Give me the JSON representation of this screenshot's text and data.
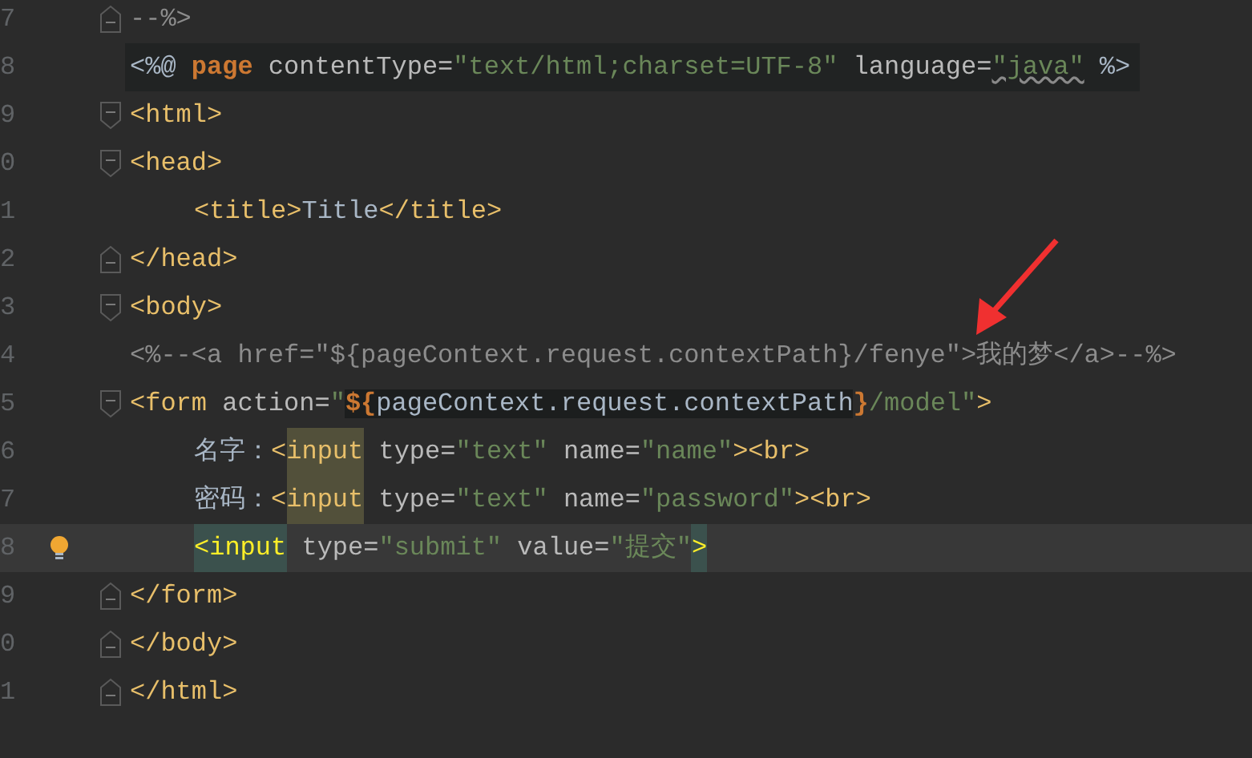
{
  "lines": [
    {
      "number": "7",
      "kind": "close",
      "current": false,
      "segments": [
        {
          "kind": "comment",
          "text": "--%>"
        }
      ]
    },
    {
      "number": "8",
      "kind": "plain",
      "current": false,
      "directive": true,
      "segments": [
        {
          "kind": "text",
          "text": "<%@"
        },
        {
          "kind": "keyword",
          "text": " page"
        },
        {
          "kind": "attr",
          "text": " contentType="
        },
        {
          "kind": "string",
          "text": "\"text/html;charset=UTF-8\""
        },
        {
          "kind": "attr",
          "text": " language="
        },
        {
          "kind": "string",
          "text": "\"java\"",
          "squiggle": true
        },
        {
          "kind": "text",
          "text": " %>"
        }
      ]
    },
    {
      "number": "9",
      "kind": "open",
      "current": false,
      "segments": [
        {
          "kind": "tag",
          "text": "<html>"
        }
      ]
    },
    {
      "number": "0",
      "kind": "open",
      "current": false,
      "segments": [
        {
          "kind": "tag",
          "text": "<head>"
        }
      ]
    },
    {
      "number": "1",
      "kind": "plain",
      "current": false,
      "indent": true,
      "segments": [
        {
          "kind": "tag",
          "text": "<title>"
        },
        {
          "kind": "text",
          "text": "Title"
        },
        {
          "kind": "tag",
          "text": "</title>"
        }
      ]
    },
    {
      "number": "2",
      "kind": "close",
      "current": false,
      "segments": [
        {
          "kind": "tag",
          "text": "</head>"
        }
      ]
    },
    {
      "number": "3",
      "kind": "open",
      "current": false,
      "segments": [
        {
          "kind": "tag",
          "text": "<body>"
        }
      ]
    },
    {
      "number": "4",
      "kind": "plain",
      "current": false,
      "segments": [
        {
          "kind": "comment",
          "text": "<%--<a href=\"${pageContext.request.contextPath}/fenye\">我的梦</a>--%>"
        }
      ]
    },
    {
      "number": "5",
      "kind": "open",
      "current": false,
      "segments": [
        {
          "kind": "tag",
          "text": "<form"
        },
        {
          "kind": "attr",
          "text": " action="
        },
        {
          "kind": "string",
          "text": "\""
        },
        {
          "kind": "el",
          "text": "${",
          "shade": true
        },
        {
          "kind": "text",
          "text": "pageContext.request.contextPath",
          "shade": true
        },
        {
          "kind": "el",
          "text": "}"
        },
        {
          "kind": "string",
          "text": "/model\""
        },
        {
          "kind": "tag",
          "text": ">"
        }
      ]
    },
    {
      "number": "6",
      "kind": "plain",
      "current": false,
      "indent": true,
      "segments": [
        {
          "kind": "text",
          "text": "名字："
        },
        {
          "kind": "tag",
          "text": "<"
        },
        {
          "kind": "tag",
          "text": "input",
          "usage": true
        },
        {
          "kind": "attr",
          "text": " type="
        },
        {
          "kind": "string",
          "text": "\"text\""
        },
        {
          "kind": "attr",
          "text": " name="
        },
        {
          "kind": "string",
          "text": "\"name\""
        },
        {
          "kind": "tag",
          "text": "><br>"
        }
      ]
    },
    {
      "number": "7",
      "kind": "plain",
      "current": false,
      "indent": true,
      "segments": [
        {
          "kind": "text",
          "text": "密码："
        },
        {
          "kind": "tag",
          "text": "<"
        },
        {
          "kind": "tag",
          "text": "input",
          "usage": true
        },
        {
          "kind": "attr",
          "text": " type="
        },
        {
          "kind": "string",
          "text": "\"text\""
        },
        {
          "kind": "attr",
          "text": " name="
        },
        {
          "kind": "string",
          "text": "\"password\""
        },
        {
          "kind": "tag",
          "text": "><br>"
        }
      ]
    },
    {
      "number": "8",
      "kind": "plain",
      "current": true,
      "bulb": true,
      "indent": true,
      "segments": [
        {
          "kind": "tag",
          "text": "<input",
          "brace_match": true
        },
        {
          "kind": "attr",
          "text": " type="
        },
        {
          "kind": "string",
          "text": "\"submit\""
        },
        {
          "kind": "attr",
          "text": " value="
        },
        {
          "kind": "string",
          "text": "\"提交\""
        },
        {
          "kind": "tag",
          "text": ">",
          "brace_match": true
        }
      ]
    },
    {
      "number": "9",
      "kind": "close",
      "current": false,
      "segments": [
        {
          "kind": "tag",
          "text": "</form>"
        }
      ]
    },
    {
      "number": "0",
      "kind": "close",
      "current": false,
      "segments": [
        {
          "kind": "tag",
          "text": "</body>"
        }
      ]
    },
    {
      "number": "1",
      "kind": "close",
      "current": false,
      "segments": [
        {
          "kind": "tag",
          "text": "</html>"
        }
      ]
    }
  ]
}
